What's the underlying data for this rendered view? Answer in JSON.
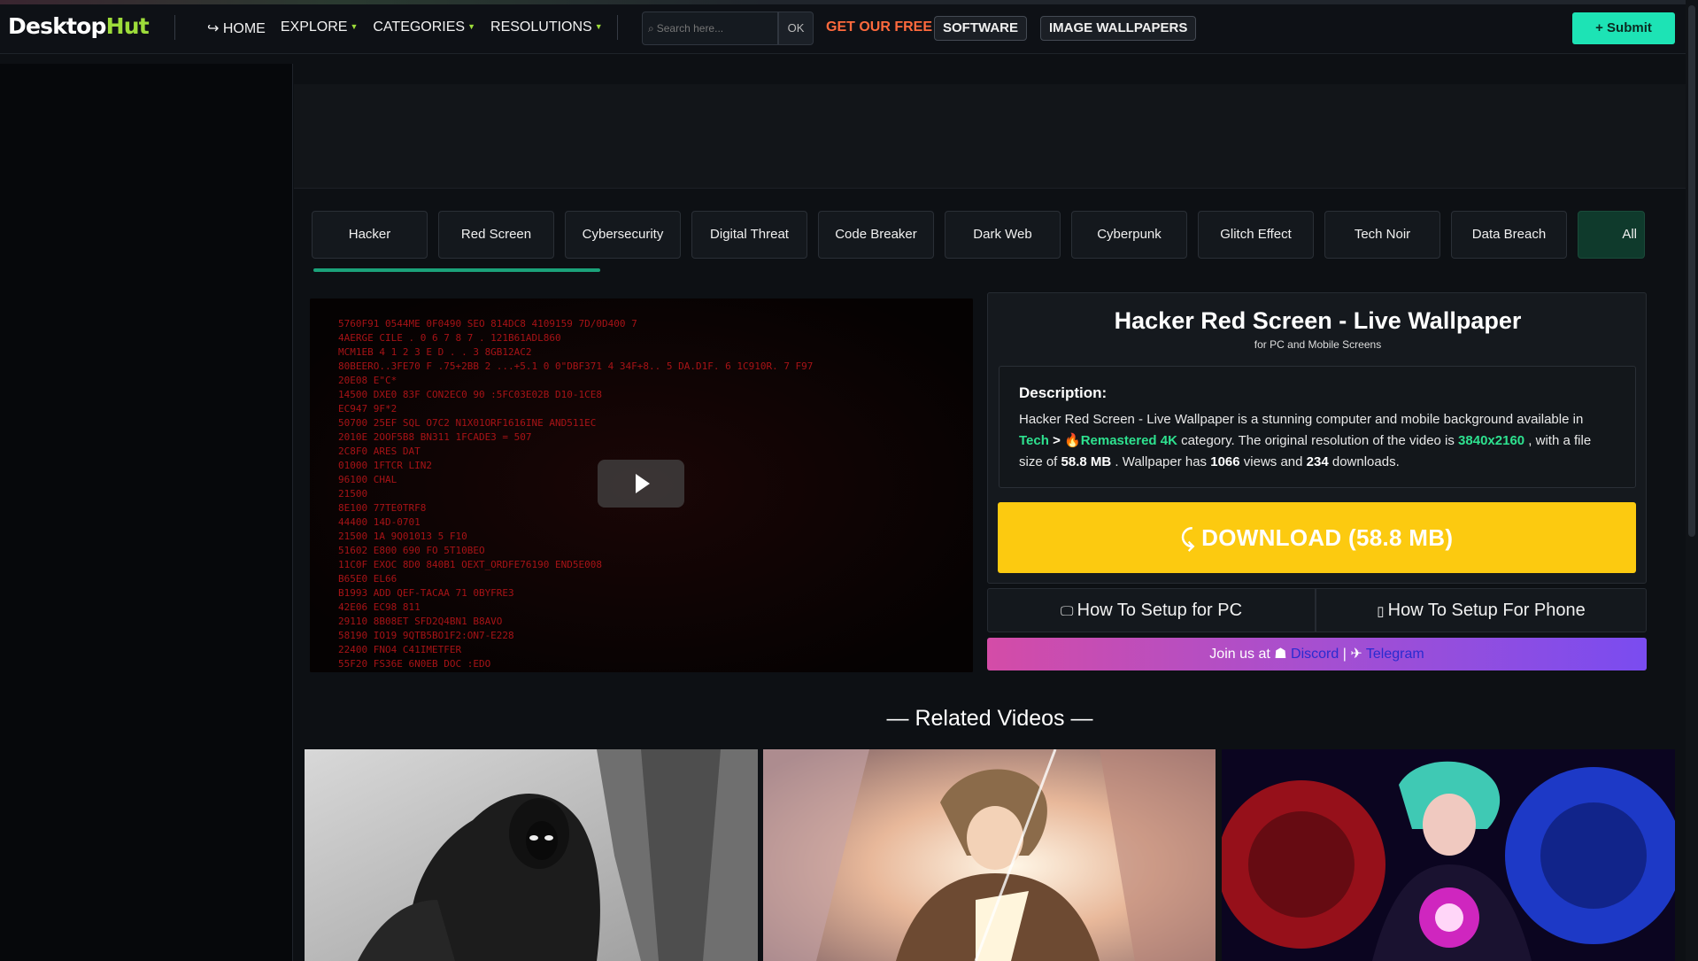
{
  "brand": {
    "logo_part1": "Desktop",
    "logo_part2": "Hut"
  },
  "nav": {
    "home": "↪ HOME",
    "explore": "EXPLORE",
    "categories": "CATEGORIES",
    "resolutions": "RESOLUTIONS"
  },
  "search": {
    "placeholder": "Search here...",
    "ok_label": "OK"
  },
  "promo": {
    "get_free": "GET OUR FREE",
    "software": "SOFTWARE",
    "image_wallpapers": "IMAGE WALLPAPERS"
  },
  "submit_label": "+ Submit",
  "tags": [
    "Hacker",
    "Red Screen",
    "Cybersecurity",
    "Digital Threat",
    "Code Breaker",
    "Dark Web",
    "Cyberpunk",
    "Glitch Effect",
    "Tech Noir",
    "Data Breach",
    "All"
  ],
  "wallpaper": {
    "title": "Hacker Red Screen - Live Wallpaper",
    "subtitle": "for PC and Mobile Screens",
    "description_heading": "Description:",
    "desc_intro": "Hacker Red Screen - Live Wallpaper is a stunning computer and mobile background available in",
    "category_parent": "Tech",
    "category_sep": " > ",
    "category_icon": "🔥",
    "category": "Remastered 4K",
    "desc_cat_suffix": " category. The original resolution of the video is ",
    "resolution": "3840x2160",
    "desc_size_prefix": " , with a file size of ",
    "file_size": "58.8 MB",
    "desc_views_prefix": " . Wallpaper has ",
    "views": "1066",
    "desc_views_mid": " views and ",
    "downloads": "234",
    "desc_downloads_suffix": " downloads.",
    "download_label": "DOWNLOAD (58.8 MB)"
  },
  "setup": {
    "pc": "How To Setup for PC",
    "phone": "How To Setup For Phone"
  },
  "community": {
    "prefix": "Join us at ",
    "discord": "Discord",
    "sep": " | ",
    "telegram": "Telegram"
  },
  "related_heading": "— Related Videos —",
  "colors": {
    "accent_green": "#2ee18f",
    "download_yellow": "#fcca10",
    "submit_teal": "#1de3b5",
    "promo_orange": "#ff6a3d"
  },
  "icons": {
    "video_play": "play-icon",
    "download": "download-icon",
    "pc": "monitor-icon",
    "phone": "phone-icon",
    "discord": "discord-icon",
    "telegram": "telegram-icon"
  }
}
